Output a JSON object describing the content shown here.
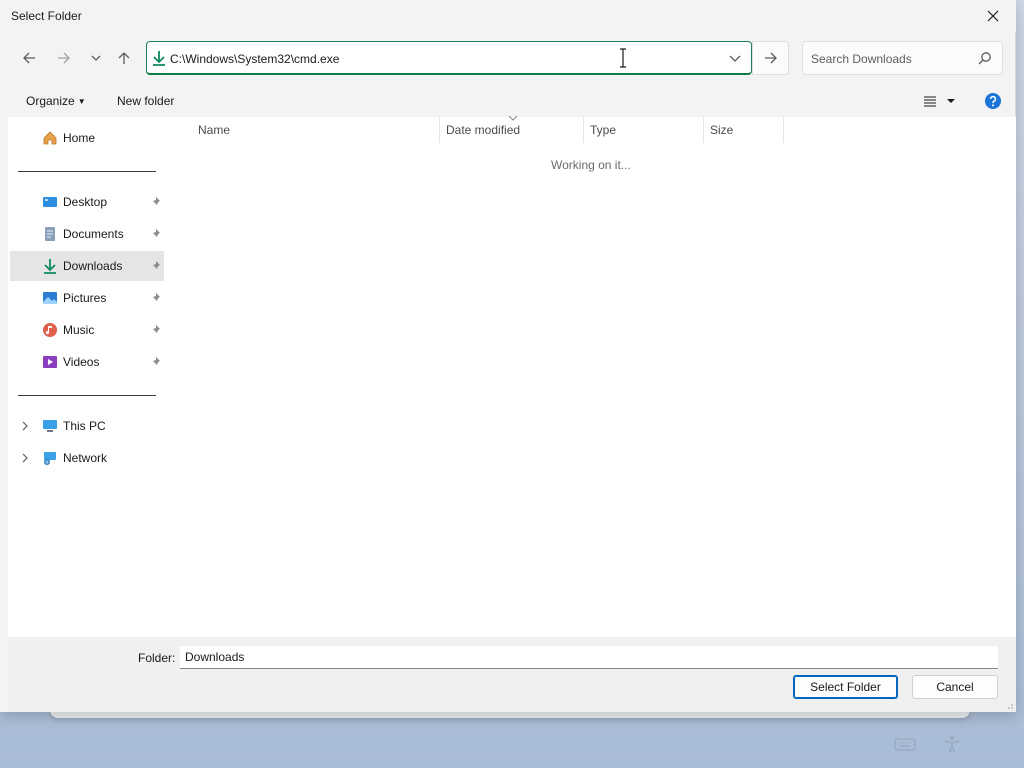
{
  "window": {
    "title": "Select Folder",
    "close_icon": "close-icon"
  },
  "navigation": {
    "back_icon": "arrow-left-icon",
    "forward_icon": "arrow-right-icon",
    "recent_icon": "chevron-down-icon",
    "up_icon": "arrow-up-icon",
    "address": "C:\\Windows\\System32\\cmd.exe",
    "address_icon": "download-arrow-icon",
    "go_icon": "arrow-right-icon",
    "search_placeholder": "Search Downloads"
  },
  "commandbar": {
    "organize": "Organize",
    "new_folder": "New folder",
    "view_icon": "list-view-icon",
    "help_icon": "help-icon"
  },
  "sidebar": {
    "items": [
      {
        "label": "Home",
        "icon": "home-icon"
      },
      {
        "label": "Desktop",
        "icon": "desktop-icon",
        "pinned": true
      },
      {
        "label": "Documents",
        "icon": "documents-icon",
        "pinned": true
      },
      {
        "label": "Downloads",
        "icon": "downloads-icon",
        "pinned": true,
        "selected": true
      },
      {
        "label": "Pictures",
        "icon": "pictures-icon",
        "pinned": true
      },
      {
        "label": "Music",
        "icon": "music-icon",
        "pinned": true
      },
      {
        "label": "Videos",
        "icon": "videos-icon",
        "pinned": true
      },
      {
        "label": "This PC",
        "icon": "computer-icon",
        "expandable": true
      },
      {
        "label": "Network",
        "icon": "network-icon",
        "expandable": true
      }
    ]
  },
  "filelist": {
    "columns": [
      "Name",
      "Date modified",
      "Type",
      "Size"
    ],
    "status": "Working on it..."
  },
  "footer": {
    "folder_label": "Folder:",
    "folder_value": "Downloads",
    "select_button": "Select Folder",
    "cancel_button": "Cancel"
  },
  "colors": {
    "accent": "#0067c0",
    "address_border": "#107c41",
    "selection": "#e5e5e5"
  }
}
